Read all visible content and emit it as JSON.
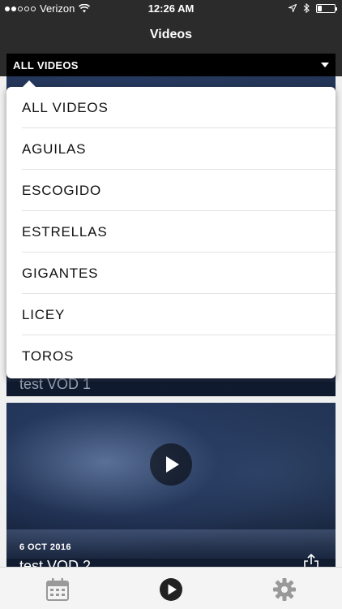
{
  "status_bar": {
    "carrier": "Verizon",
    "time": "12:26 AM",
    "signal_bars_filled": 2,
    "signal_bars_total": 5,
    "battery_level": 0.25
  },
  "nav": {
    "title": "Videos"
  },
  "filter": {
    "selected": "ALL VIDEOS"
  },
  "dropdown": {
    "options": [
      "ALL VIDEOS",
      "AGUILAS",
      "ESCOGIDO",
      "ESTRELLAS",
      "GIGANTES",
      "LICEY",
      "TOROS"
    ]
  },
  "videos": [
    {
      "date": "",
      "title": "test VOD 1"
    },
    {
      "date": "6 OCT 2016",
      "title": "test VOD 2"
    }
  ],
  "tab_bar": {
    "tabs": [
      {
        "icon": "calendar-icon"
      },
      {
        "icon": "play-circle-icon"
      },
      {
        "icon": "gear-icon"
      }
    ]
  },
  "colors": {
    "header_bg": "#2b2b2b",
    "filter_bg": "#000000",
    "tab_active": "#222222",
    "tab_inactive": "#999999"
  }
}
